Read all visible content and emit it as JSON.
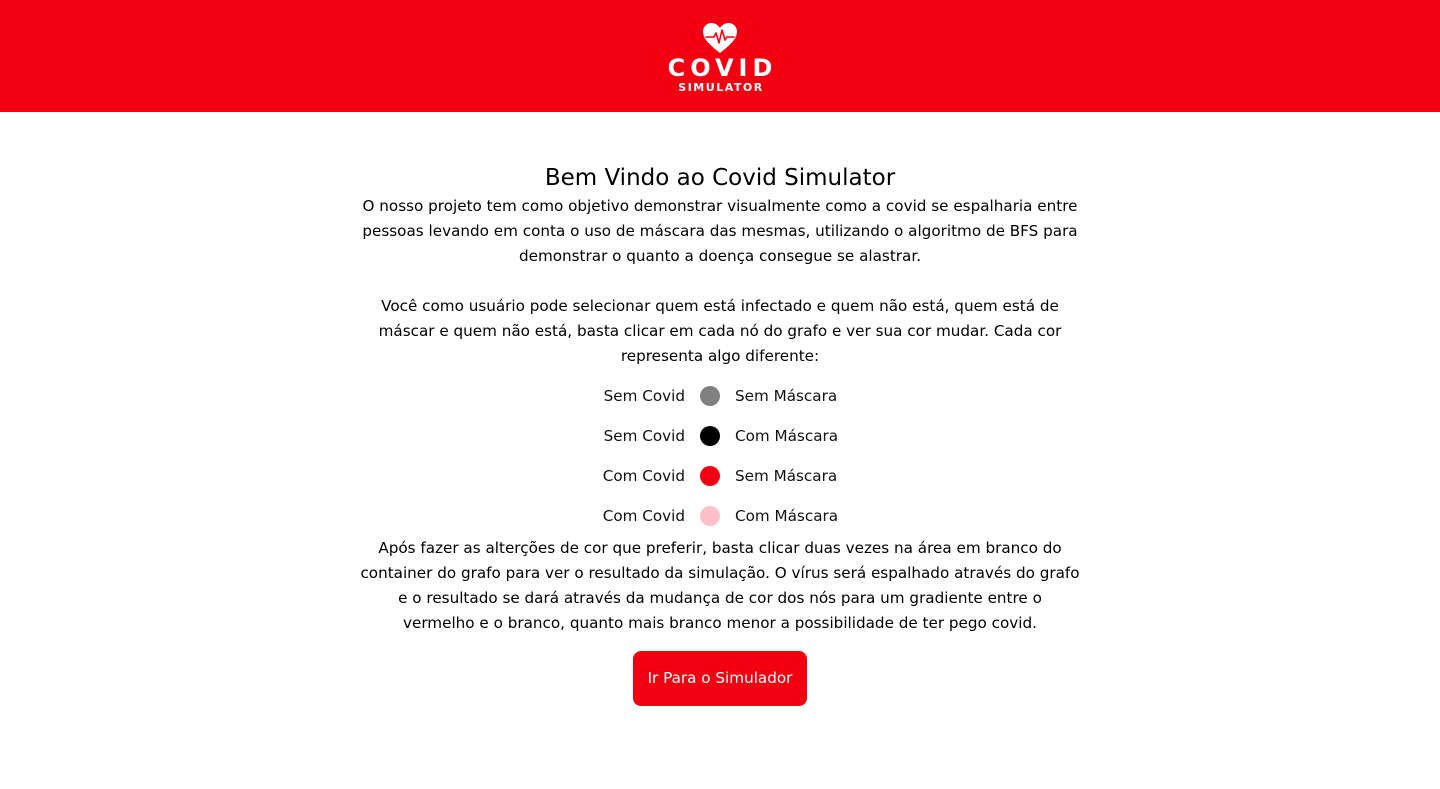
{
  "header": {
    "logo_icon": "heart-pulse-icon",
    "logo_title": "COVID",
    "logo_subtitle": "SIMULATOR",
    "background_color": "#f20011"
  },
  "main": {
    "title": "Bem Vindo ao Covid Simulator",
    "intro_paragraph": "O nosso projeto tem como objetivo demonstrar visualmente como a covid se espalharia entre pessoas levando em conta o uso de máscara das mesmas, utilizando o algoritmo de BFS para demonstrar o quanto a doença consegue se alastrar.",
    "instructions_paragraph": "Você como usuário pode selecionar quem está infectado e quem não está, quem está de máscar e quem não está, basta clicar em cada nó do grafo e ver sua cor mudar. Cada cor representa algo diferente:",
    "legend": [
      {
        "left": "Sem Covid",
        "right": "Sem Máscara",
        "color": "#808080"
      },
      {
        "left": "Sem Covid",
        "right": "Com Máscara",
        "color": "#000000"
      },
      {
        "left": "Com Covid",
        "right": "Sem Máscara",
        "color": "#f20011"
      },
      {
        "left": "Com Covid",
        "right": "Com Máscara",
        "color": "#ffc0cb"
      }
    ],
    "result_paragraph": "Após fazer as alterções de cor que preferir, basta clicar duas vezes na área em branco do container do grafo para ver o resultado da simulação. O vírus será espalhado através do grafo e o resultado se dará através da mudança de cor dos nós para um gradiente entre o vermelho e o branco, quanto mais branco menor a possibilidade de ter pego covid.",
    "cta_label": "Ir Para o Simulador",
    "accent_color": "#f20011"
  }
}
